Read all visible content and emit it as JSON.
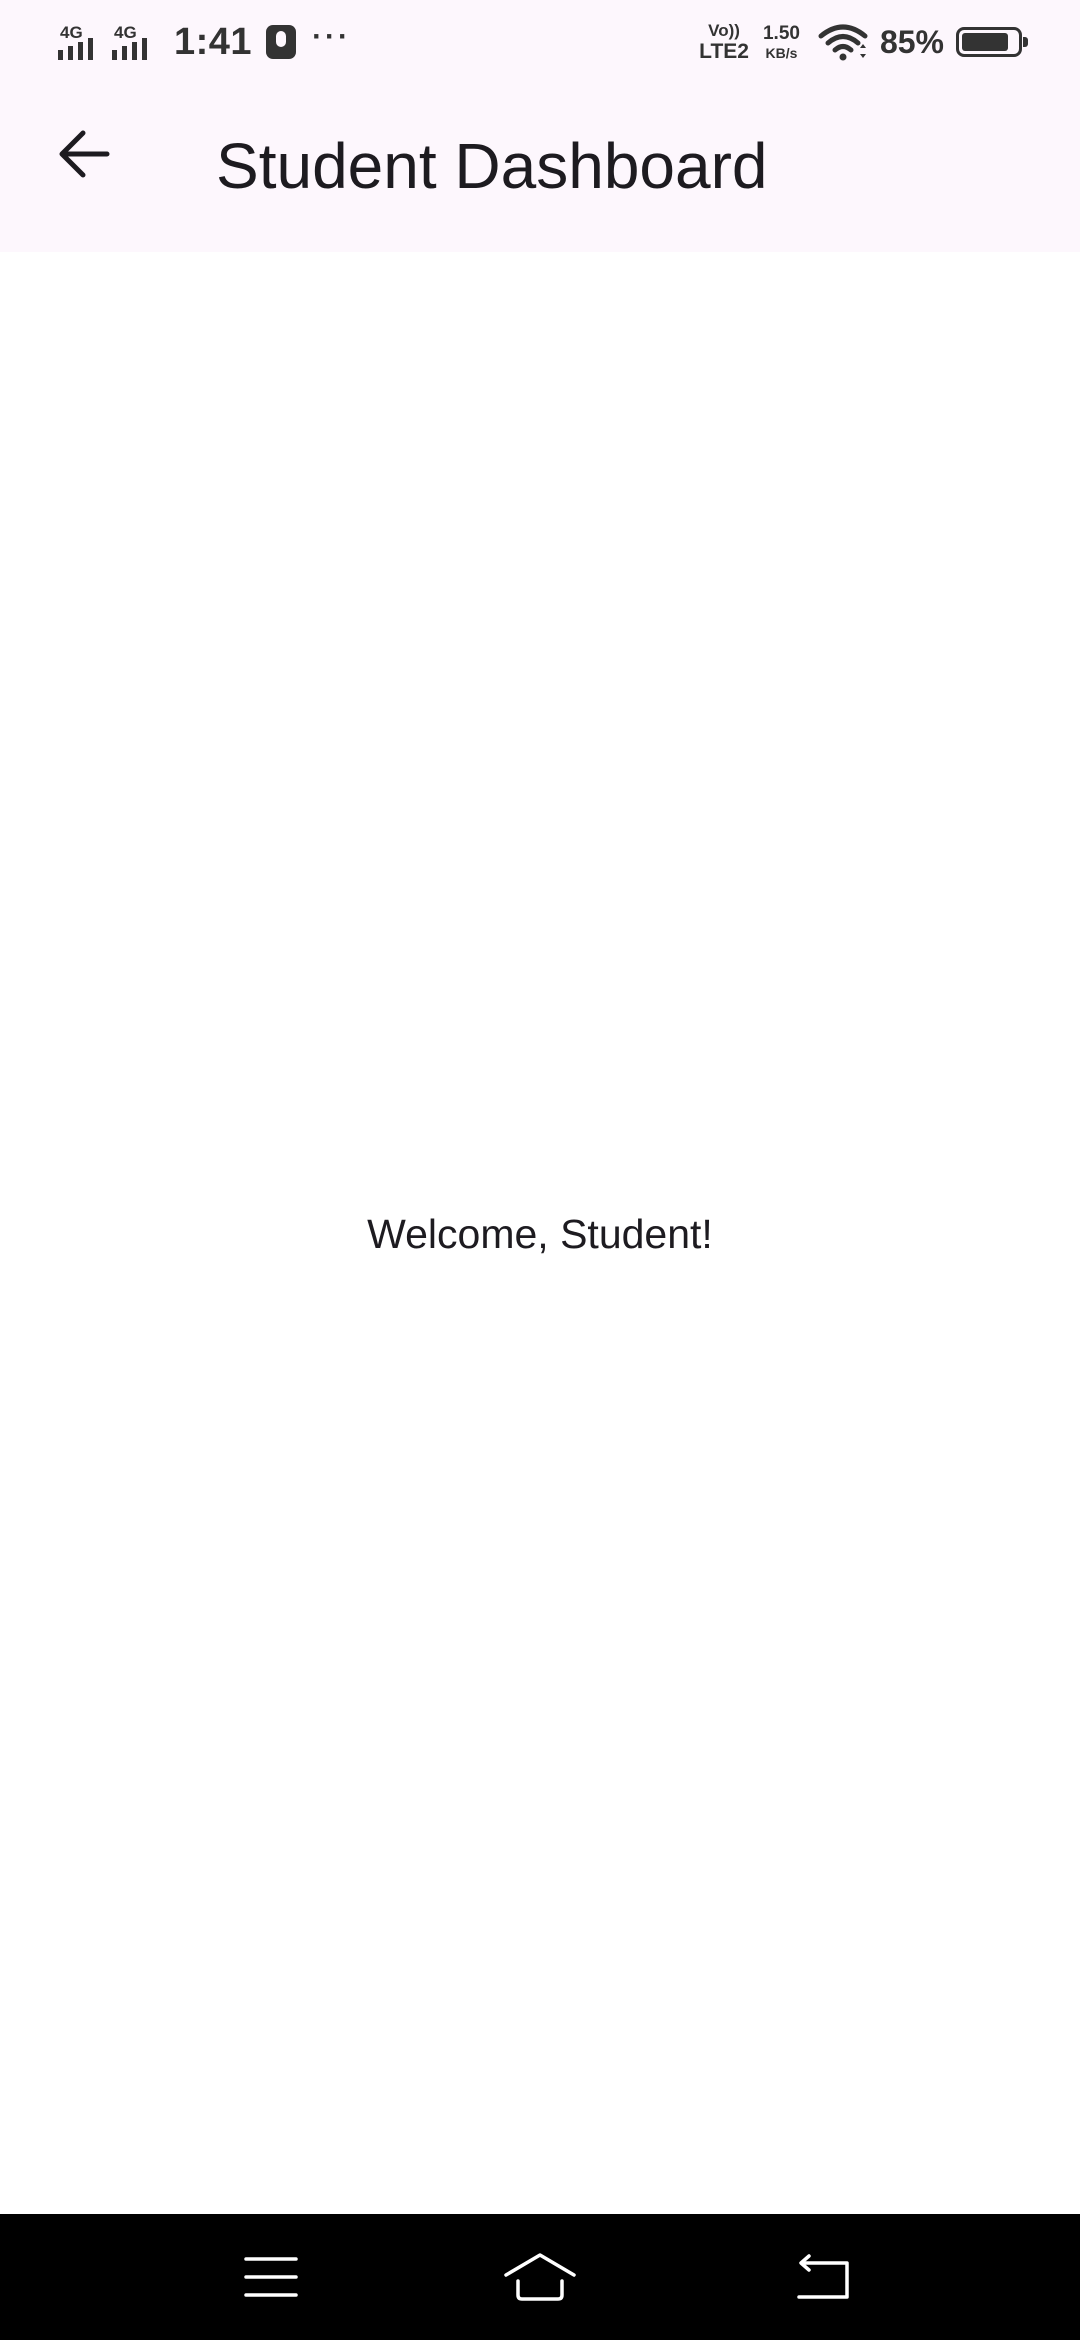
{
  "status_bar": {
    "sim1_network": "4G",
    "sim2_network": "4G",
    "time": "1:41",
    "volte_top": "Vo))",
    "volte_bottom": "LTE2",
    "speed_value": "1.50",
    "speed_unit": "KB/s",
    "battery_percent": "85%",
    "battery_level": 0.85,
    "icons": [
      "signal-icon",
      "signal-icon",
      "mic-icon",
      "more-icon",
      "wifi-icon",
      "battery-icon"
    ]
  },
  "app_bar": {
    "back_icon": "arrow-back-icon",
    "title": "Student Dashboard",
    "background": "#fdf7fd"
  },
  "main": {
    "welcome_text": "Welcome, Student!"
  },
  "nav_bar": {
    "buttons": [
      "menu-icon",
      "home-icon",
      "back-icon"
    ],
    "background": "#000000"
  }
}
